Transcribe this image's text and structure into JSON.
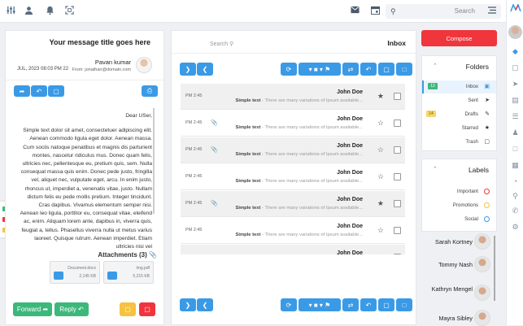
{
  "topbar": {
    "icons": [
      "sliders-icon",
      "user-icon",
      "bell-icon",
      "fullscreen-icon"
    ],
    "right_icons": [
      "mail-icon",
      "calendar-icon"
    ],
    "search_placeholder": "Search"
  },
  "message": {
    "title": "Your message title goes here",
    "sender_name": "Pavan kumar",
    "sender_email": "From: jonathan@domain.com",
    "date": "JUL, 2023 08:03 PM 22",
    "greeting": "Dear USer,",
    "paragraphs": [
      "Simple text dolor sit amet, consectetuer adipiscing elit. Aenean commodo ligula eget dolor. Aenean massa. Cum sociis natoque penatibus et magnis dis parturient montes, nascetur ridiculus mus. Donec quam felis, ultricies nec, pellentesque eu, pretium quis, sem. Nulla consequat massa quis enim. Donec pede justo, fringilla vel, aliquet nec, vulputate eget, arcu. In enim justo, rhoncus ut, imperdiet a, venenatis vitae, justo. Nullam dictum felis eu pede mollis pretium. Integer tincidunt. Cras dapibus. Vivamus elementum semper nisi.",
      "Aenean leo ligula, porttitor eu, consequat vitae, eleifend ac, enim. Aliquam lorem ante, dapibus in, viverra quis, feugiat a, tellus. Phasellus viverra nulla ut metus varius laoreet. Quisque rutrum. Aenean imperdiet. Etiam ultricies nisi vel"
    ],
    "attachments_title": "Attachments (3)",
    "attachments": [
      {
        "name": "Document.docx",
        "size": "2,145 KB"
      },
      {
        "name": "Img.pdf",
        "size": "5,215 KB"
      }
    ],
    "forward_label": "Forward",
    "reply_label": "Reply"
  },
  "inbox": {
    "title": "Inbox",
    "search_placeholder": "Search",
    "emails": [
      {
        "time": "PM 2:45",
        "from": "John Doe",
        "subject": "Simple text",
        "snippet": "There are many variations of Ipsum available...",
        "starred": true,
        "attachment": false
      },
      {
        "time": "PM 2:45",
        "from": "John Doe",
        "subject": "Simple text",
        "snippet": "There are many variations of Ipsum available...",
        "starred": false,
        "attachment": true
      },
      {
        "time": "PM 2:45",
        "from": "John Doe",
        "subject": "Simple text",
        "snippet": "There are many variations of Ipsum available...",
        "starred": false,
        "attachment": true
      },
      {
        "time": "PM 2:45",
        "from": "John Doe",
        "subject": "Simple text",
        "snippet": "There are many variations of Ipsum available...",
        "starred": false,
        "attachment": false
      },
      {
        "time": "PM 2:45",
        "from": "John Doe",
        "subject": "Simple text",
        "snippet": "There are many variations of Ipsum available...",
        "starred": true,
        "attachment": true
      },
      {
        "time": "PM 2:45",
        "from": "John Doe",
        "subject": "Simple text",
        "snippet": "There are many variations of Ipsum available...",
        "starred": false,
        "attachment": false
      },
      {
        "time": "PM 2:45",
        "from": "John Doe",
        "subject": "",
        "snippet": "",
        "starred": false,
        "attachment": false
      }
    ]
  },
  "compose_label": "Compose",
  "folders": {
    "title": "Folders",
    "items": [
      {
        "label": "Inbox",
        "icon": "inbox-icon",
        "badge": "12",
        "active": true
      },
      {
        "label": "Sent",
        "icon": "send-icon",
        "badge": ""
      },
      {
        "label": "Drafts",
        "icon": "draft-icon",
        "badge": "14"
      },
      {
        "label": "Starred",
        "icon": "star-icon",
        "badge": ""
      },
      {
        "label": "Trash",
        "icon": "trash-icon",
        "badge": ""
      }
    ]
  },
  "labels": {
    "title": "Labels",
    "items": [
      {
        "label": "Important",
        "color": "#f0353d"
      },
      {
        "label": "Promotions",
        "color": "#f5c242"
      },
      {
        "label": "Social",
        "color": "#3a9ae6"
      }
    ]
  },
  "contacts": [
    {
      "name": "Sarah Kortney"
    },
    {
      "name": "Tommy Nash"
    },
    {
      "name": "Kathryn Mengel"
    },
    {
      "name": "Mayra Sibley"
    }
  ],
  "colors": {
    "primary": "#3a9ae6",
    "danger": "#f0353d",
    "success": "#3cb87a",
    "warning": "#f5c242"
  }
}
